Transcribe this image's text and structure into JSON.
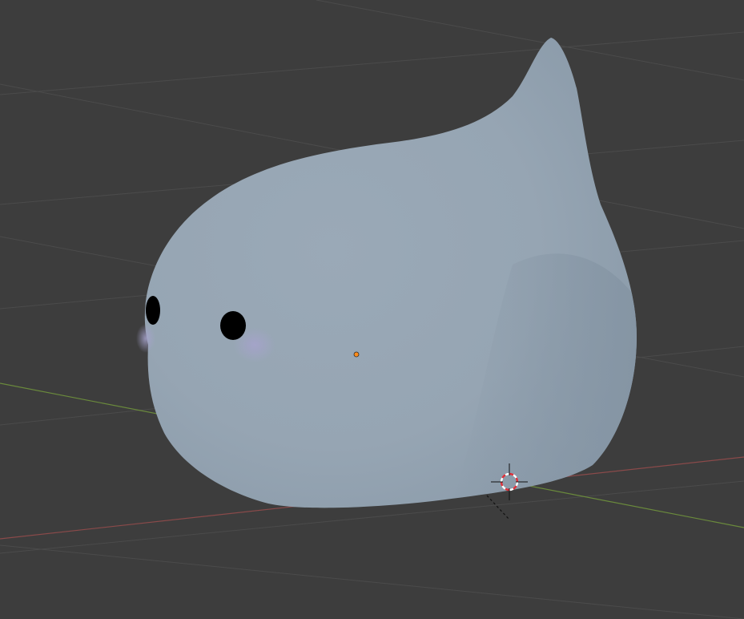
{
  "viewport": {
    "background_color": "#3d3d3d",
    "grid_line_color": "#4b4b4b",
    "x_axis_color": "#8a4a4a",
    "y_axis_color": "#6a8a3c"
  },
  "object": {
    "kind": "blob-character-mesh",
    "body_color": "#97a6b4",
    "shadow_color": "#8797a6",
    "eye_color": "#000000",
    "blush_color": "#a6a3cc",
    "origin_color": "#ff8c1a"
  },
  "cursor_3d": {
    "icon": "3d-cursor-icon",
    "ring_color_a": "#ffffff",
    "ring_color_b": "#e0303a"
  }
}
